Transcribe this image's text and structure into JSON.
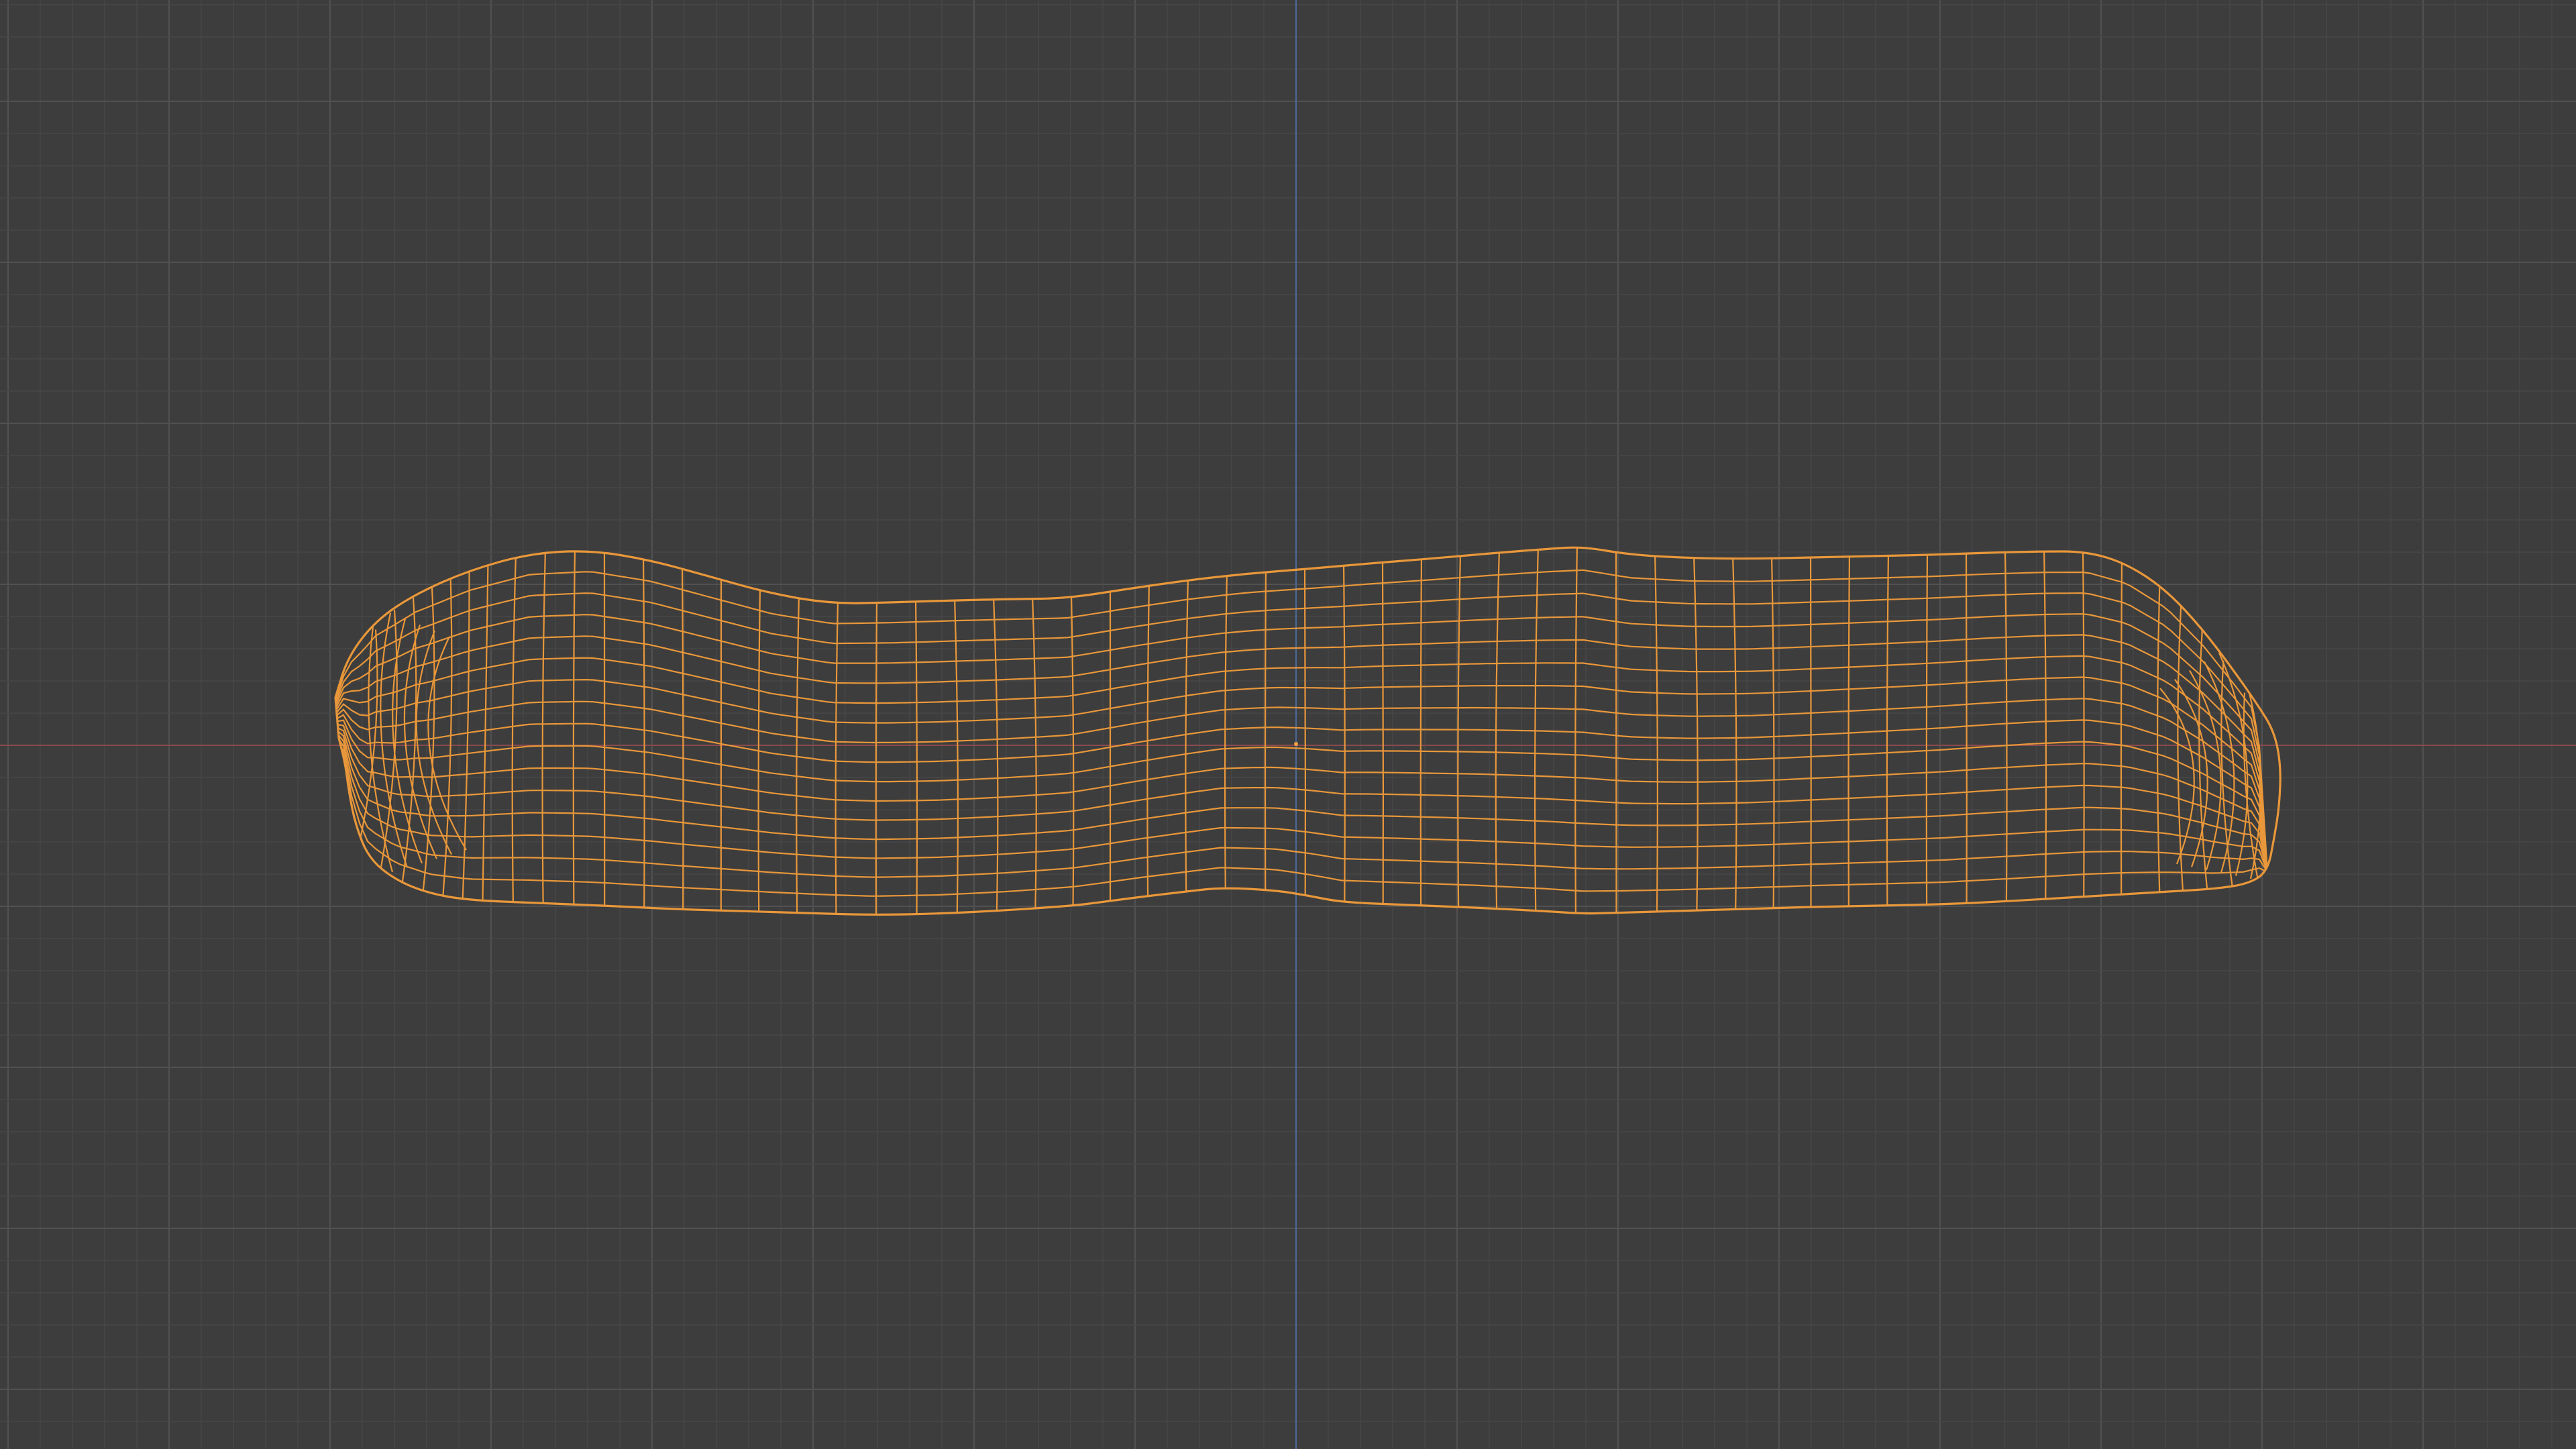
{
  "viewport": {
    "view": "front-orthographic",
    "shading": "wireframe",
    "grid": true
  },
  "colors": {
    "background": "#3d3d3d",
    "grid_minor": "#474747",
    "grid_major": "#515151",
    "x_axis": "#8a4a4e",
    "z_axis": "#4a6a9a",
    "wire_selected": "#e8973a",
    "origin_dot": "#f0a040"
  },
  "object": {
    "type": "mesh",
    "selected": true
  }
}
